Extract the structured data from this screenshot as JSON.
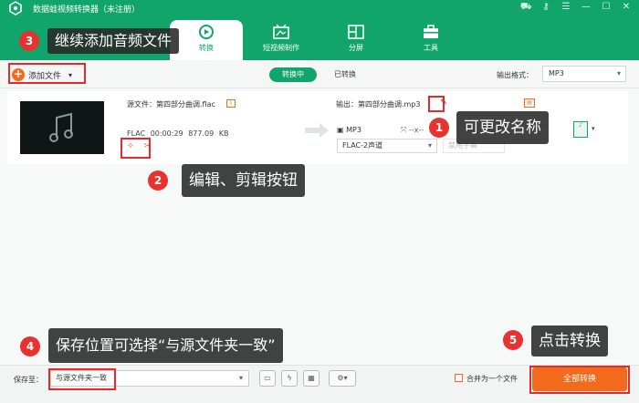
{
  "app": {
    "title": "数据蛙视频转换器（未注册）",
    "window_controls": [
      "cart-icon",
      "key-icon",
      "menu-icon",
      "minimize-icon",
      "maximize-icon",
      "close-icon"
    ]
  },
  "nav": {
    "tabs": [
      {
        "label": "转换",
        "icon": "convert-icon",
        "active": true
      },
      {
        "label": "短视频制作",
        "icon": "video-maker-icon",
        "active": false
      },
      {
        "label": "分屏",
        "icon": "split-screen-icon",
        "active": false
      },
      {
        "label": "工具",
        "icon": "toolbox-icon",
        "active": false
      }
    ]
  },
  "toolbar": {
    "add_file": "添加文件",
    "seg_converting": "转换中",
    "seg_converted": "已转换",
    "output_format_label": "输出格式：",
    "output_format_value": "MP3"
  },
  "file": {
    "source_name": "源文件：第四部分曲调.flac",
    "format": "FLAC",
    "duration": "00:00:29",
    "size": "877.09 KB",
    "output_name": "输出：第四部分曲调.mp3",
    "output_format": "MP3",
    "output_res": "--x--",
    "channel": "FLAC-2声道",
    "subtitle": "禁用字幕"
  },
  "bottom": {
    "save_to_label": "保存至：",
    "save_to_value": "与源文件夹一致",
    "merge_label": "合并为一个文件",
    "convert_all": "全部转换"
  },
  "annotations": [
    {
      "num": "1",
      "text": "可更改名称"
    },
    {
      "num": "2",
      "text": "编辑、剪辑按钮"
    },
    {
      "num": "3",
      "text": "继续添加音频文件"
    },
    {
      "num": "4",
      "text": "保存位置可选择“与源文件夹一致”"
    },
    {
      "num": "5",
      "text": "点击转换"
    }
  ],
  "colors": {
    "brand_green": "#12a56b",
    "accent_orange": "#f26b1d",
    "annotation_red": "#e42b2b"
  }
}
